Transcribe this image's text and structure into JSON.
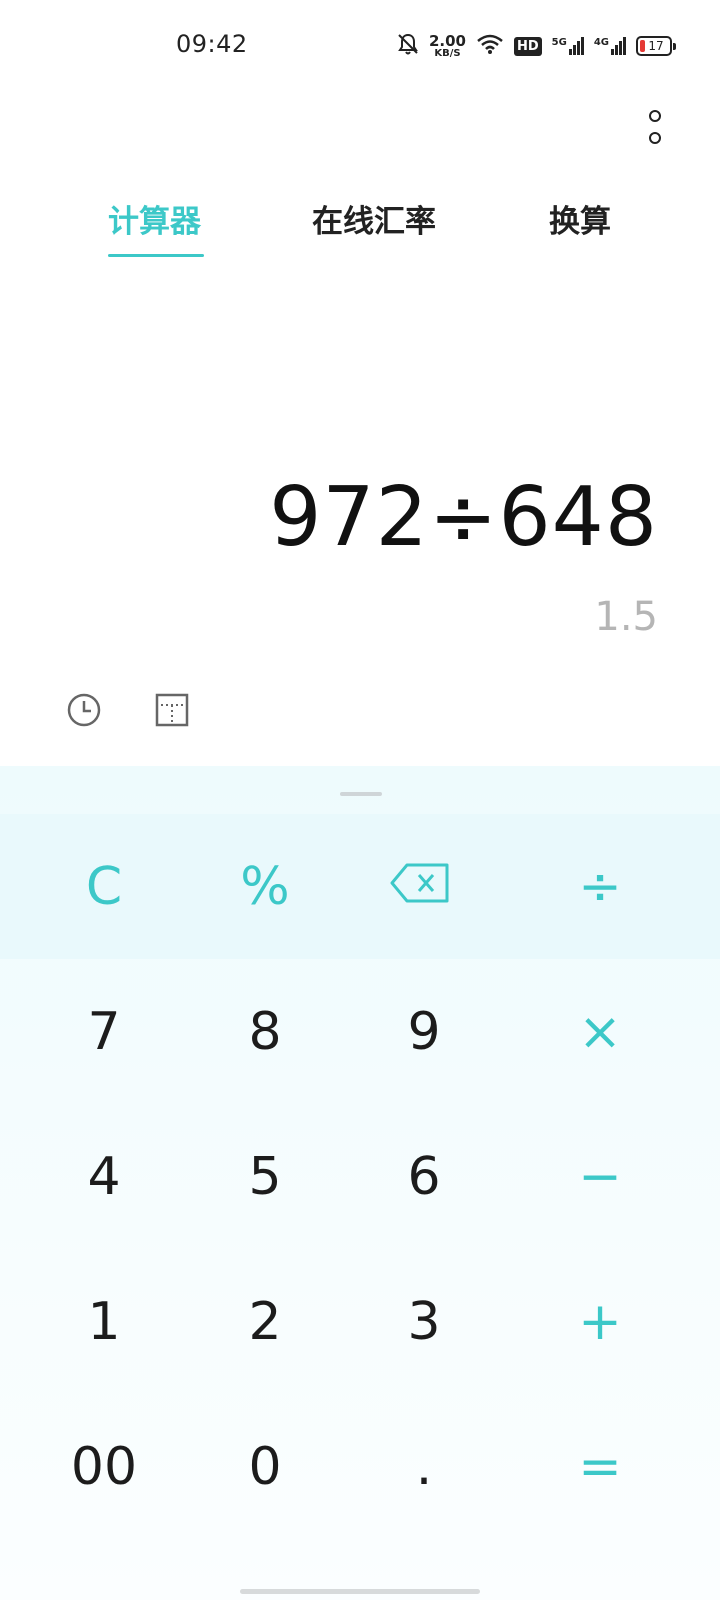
{
  "status_bar": {
    "time": "09:42",
    "speed_value": "2.00",
    "speed_unit": "KB/S",
    "hd_label": "HD",
    "net1_label": "5G",
    "net2_label": "4G",
    "battery": "17",
    "icons": [
      "mute-bell-icon",
      "wifi-icon",
      "signal-icon",
      "battery-icon"
    ]
  },
  "tabs": [
    {
      "label": "计算器",
      "active": true
    },
    {
      "label": "在线汇率",
      "active": false
    },
    {
      "label": "换算",
      "active": false
    }
  ],
  "display": {
    "expression": "972÷648",
    "result": "1.5"
  },
  "tools": [
    "history-clock-icon",
    "scientific-mode-icon"
  ],
  "keys": {
    "row1": [
      "C",
      "%",
      "backspace-icon",
      "÷"
    ],
    "row2": [
      "7",
      "8",
      "9",
      "×"
    ],
    "row3": [
      "4",
      "5",
      "6",
      "−"
    ],
    "row4": [
      "1",
      "2",
      "3",
      "+"
    ],
    "row5": [
      "00",
      "0",
      ".",
      "="
    ]
  },
  "colors": {
    "accent": "#3cc8c8",
    "text": "#1c1c1c",
    "result": "#b5b5b5"
  }
}
